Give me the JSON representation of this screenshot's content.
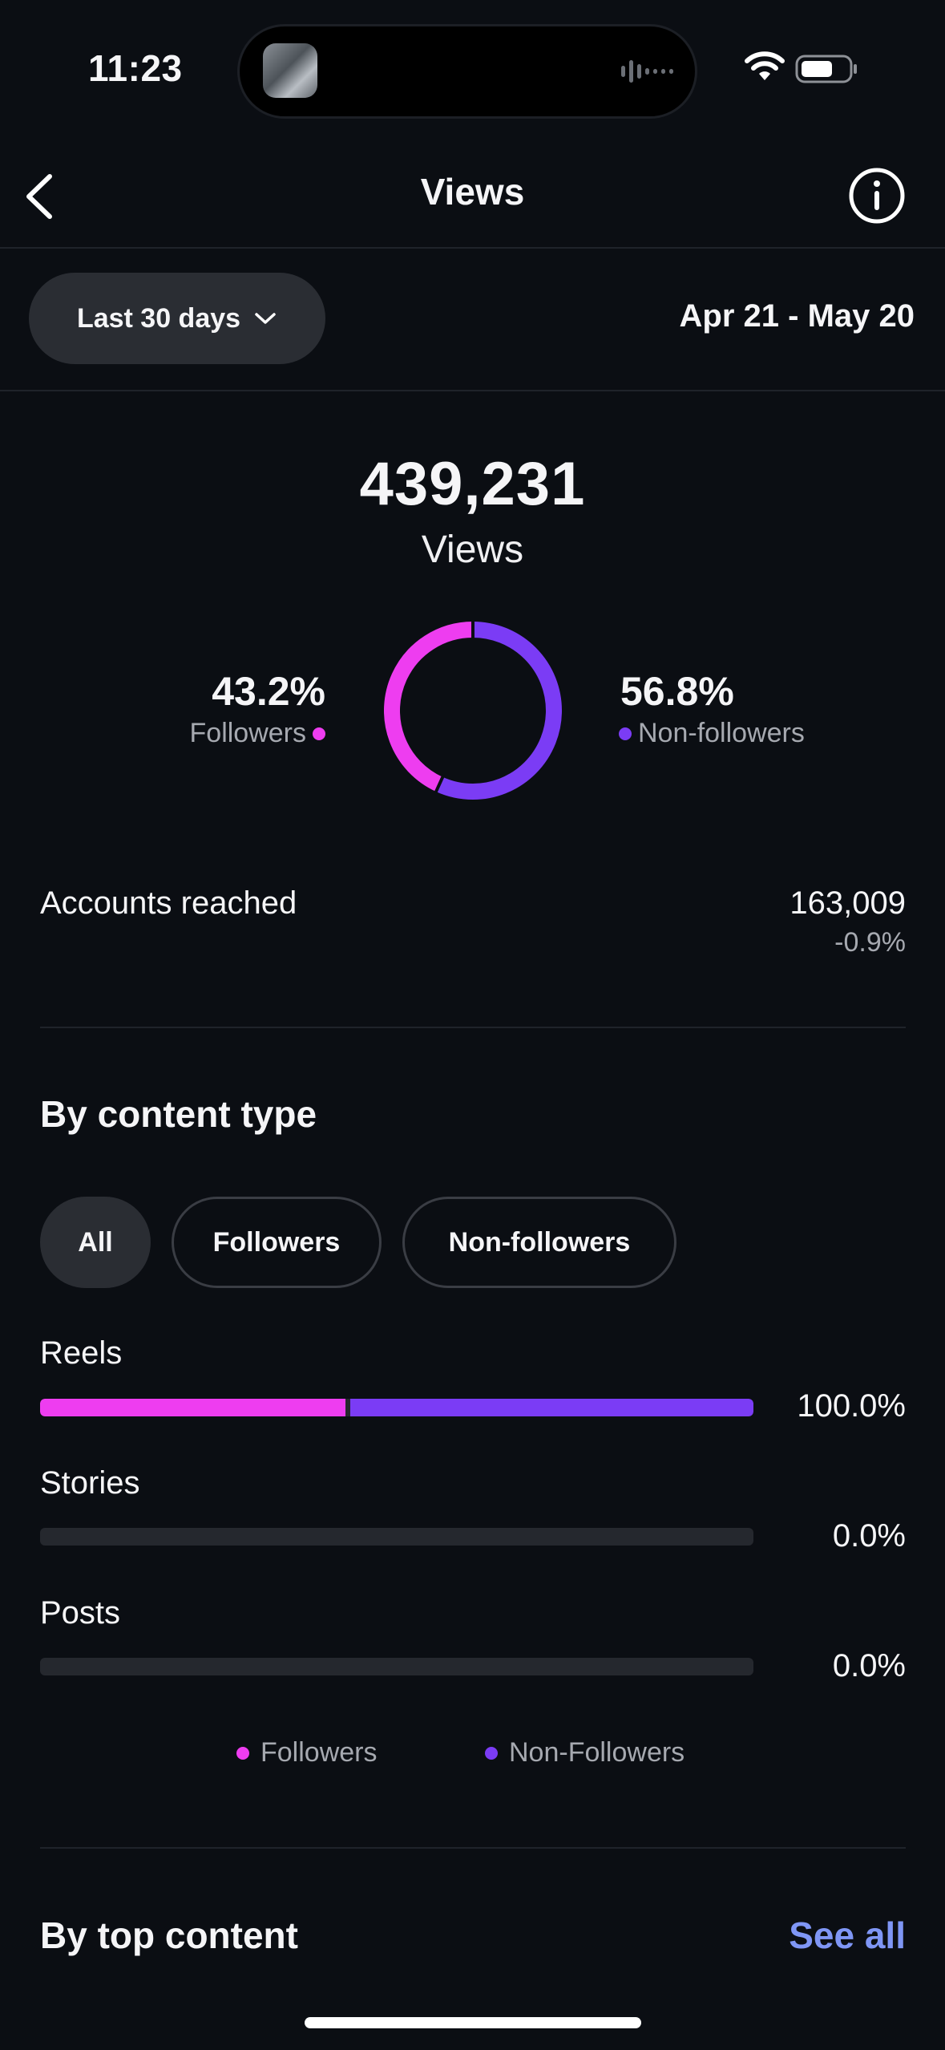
{
  "status_bar": {
    "time": "11:23"
  },
  "header": {
    "title": "Views"
  },
  "filter": {
    "range_label": "Last 30 days",
    "date_range": "Apr 21 - May 20"
  },
  "summary": {
    "total": "439,231",
    "total_label": "Views",
    "followers_pct": "43.2%",
    "followers_label": "Followers",
    "followers_fraction": 0.432,
    "nonfollowers_pct": "56.8%",
    "nonfollowers_label": "Non-followers",
    "nonfollowers_fraction": 0.568
  },
  "accounts_reached": {
    "label": "Accounts reached",
    "value": "163,009",
    "change": "-0.9%"
  },
  "content_type": {
    "title": "By content type",
    "chips": [
      {
        "label": "All",
        "active": true
      },
      {
        "label": "Followers",
        "active": false
      },
      {
        "label": "Non-followers",
        "active": false
      }
    ],
    "rows": [
      {
        "label": "Reels",
        "pct": "100.0%",
        "followers_fraction": 0.432,
        "nonfollowers_fraction": 0.568
      },
      {
        "label": "Stories",
        "pct": "0.0%",
        "followers_fraction": 0,
        "nonfollowers_fraction": 0
      },
      {
        "label": "Posts",
        "pct": "0.0%",
        "followers_fraction": 0,
        "nonfollowers_fraction": 0
      }
    ],
    "legend": {
      "followers": "Followers",
      "nonfollowers": "Non-Followers"
    }
  },
  "top_content": {
    "title": "By top content",
    "see_all": "See all"
  },
  "colors": {
    "followers": "#ee3df0",
    "nonfollowers": "#7b3cf5",
    "link": "#7f96f5",
    "background": "#0b0e13"
  },
  "icons": {
    "back": "chevron-left-icon",
    "info": "info-circle-icon",
    "dropdown": "chevron-down-icon",
    "wifi": "wifi-icon",
    "battery": "battery-icon"
  }
}
